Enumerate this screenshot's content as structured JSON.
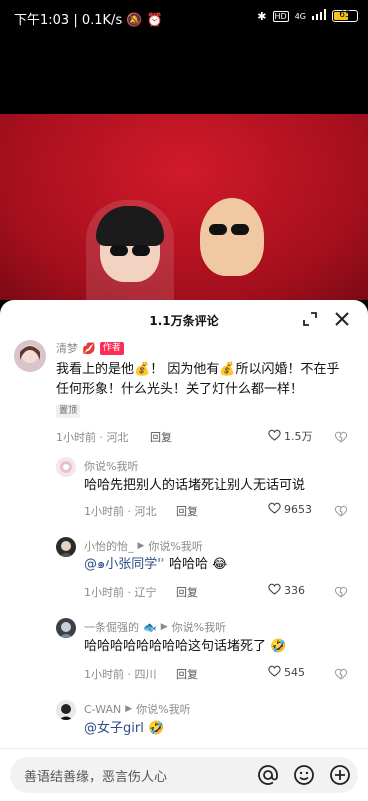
{
  "status_bar": {
    "time": "下午1:03",
    "speed": "0.1K/s",
    "network": "4G",
    "battery": "65",
    "battery_level": 0.65
  },
  "sheet": {
    "title": "1.1万条评论"
  },
  "comments": [
    {
      "name": "清梦",
      "badge": "作者",
      "text_a": "我看上的是他",
      "text_b": "！ 因为他有",
      "text_c": "所以闪婚！不在乎任何形象！什么光头！关了灯什么都一样！",
      "pin": "置顶",
      "time": "1小时前 · 河北",
      "reply": "回复",
      "likes": "1.5万"
    }
  ],
  "replies": [
    {
      "name": "你说%我听",
      "text": "哈哈先把别人的话堵死让别人无话可说",
      "time": "1小时前 · 河北",
      "reply": "回复",
      "likes": "9653"
    },
    {
      "name": "小怡的怡_",
      "reply_to": "你说%我听",
      "mention": "@๑小张同学'ʾ",
      "text": "哈哈哈",
      "time": "1小时前 · 辽宁",
      "reply": "回复",
      "likes": "336"
    },
    {
      "name": "一条倔强的",
      "reply_to": "你说%我听",
      "text": "哈哈哈哈哈哈哈哈这句话堵死了",
      "time": "1小时前 · 四川",
      "reply": "回复",
      "likes": "545"
    },
    {
      "name": "C-WAN",
      "reply_to": "你说%我听",
      "mention": "@女子girl"
    }
  ],
  "input_bar": {
    "placeholder": "善语结善缘，恶言伤人心"
  }
}
